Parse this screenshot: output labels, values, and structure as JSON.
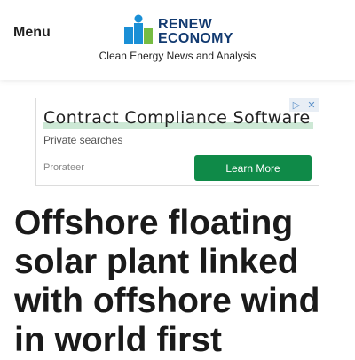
{
  "header": {
    "menu_label": "Menu",
    "logo": {
      "line1": "RENEW",
      "line2": "ECONOMY",
      "icon": "renew-economy-logo-icon"
    },
    "tagline": "Clean Energy News and Analysis"
  },
  "ad": {
    "title": "Contract Compliance Software",
    "subtitle": "Private searches",
    "brand": "Prorateer",
    "button_label": "Learn More",
    "adchoices_icon": "play-triangle-icon",
    "close_icon": "close-icon"
  },
  "article": {
    "headline": "Offshore floating solar plant linked with offshore wind in world first"
  },
  "colors": {
    "logo_blue": "#1a8fd6",
    "logo_green": "#76bc43",
    "logo_navy": "#123a70",
    "button_green": "#0f8a48",
    "ad_highlight": "#cde8d5"
  }
}
